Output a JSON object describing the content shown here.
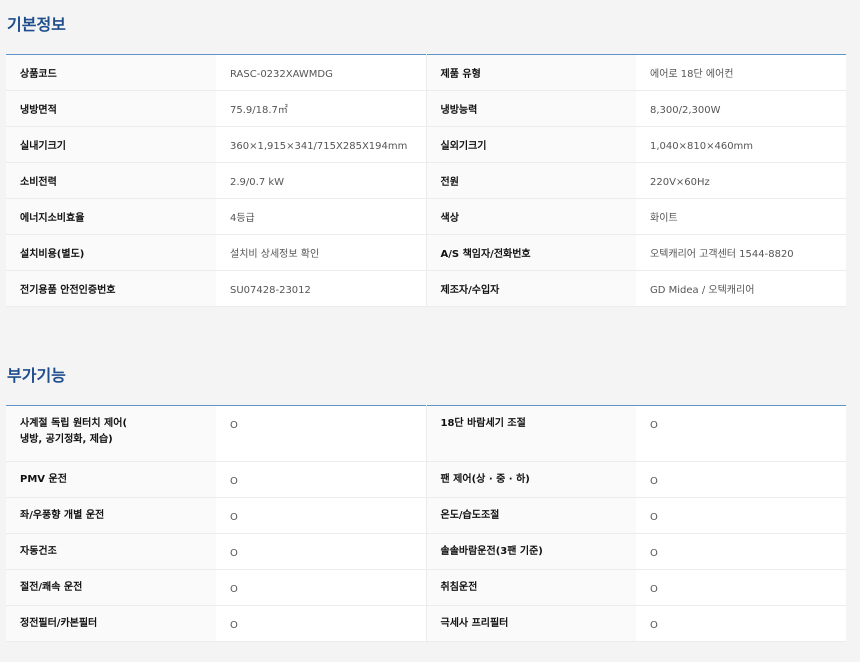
{
  "basic": {
    "title": "기본정보",
    "rows": [
      [
        {
          "label": "상품코드",
          "value": "RASC-0232XAWMDG"
        },
        {
          "label": "제품 유형",
          "value": "에어로 18단 에어컨"
        }
      ],
      [
        {
          "label": "냉방면적",
          "value": "75.9/18.7㎡"
        },
        {
          "label": "냉방능력",
          "value": "8,300/2,300W"
        }
      ],
      [
        {
          "label": "실내기크기",
          "value": "360×1,915×341/715X285X194mm"
        },
        {
          "label": "실외기크기",
          "value": "1,040×810×460mm"
        }
      ],
      [
        {
          "label": "소비전력",
          "value": "2.9/0.7 kW"
        },
        {
          "label": "전원",
          "value": "220V×60Hz"
        }
      ],
      [
        {
          "label": "에너지소비효율",
          "value": "4등급"
        },
        {
          "label": "색상",
          "value": "화이트"
        }
      ],
      [
        {
          "label": "설치비용(별도)",
          "value": "설치비 상세정보 확인"
        },
        {
          "label": "A/S 책임자/전화번호",
          "value": "오텍캐리어 고객센터 1544-8820"
        }
      ],
      [
        {
          "label": "전기용품 안전인증번호",
          "value": "SU07428-23012"
        },
        {
          "label": "제조자/수입자",
          "value": "GD Midea / 오텍캐리어"
        }
      ]
    ]
  },
  "extra": {
    "title": "부가기능",
    "rows": [
      [
        {
          "label": "사계절 독립 원터치 제어(\n냉방, 공기정화, 제습)",
          "value": "O"
        },
        {
          "label": "18단 바람세기 조절",
          "value": "O"
        }
      ],
      [
        {
          "label": "PMV 운전",
          "value": "O"
        },
        {
          "label": "팬 제어(상 · 중 · 하)",
          "value": "O"
        }
      ],
      [
        {
          "label": "좌/우풍향 개별 운전",
          "value": "O"
        },
        {
          "label": "온도/습도조절",
          "value": "O"
        }
      ],
      [
        {
          "label": "자동건조",
          "value": "O"
        },
        {
          "label": "솔솔바람운전(3팬 기준)",
          "value": "O"
        }
      ],
      [
        {
          "label": "절전/쾌속 운전",
          "value": "O"
        },
        {
          "label": "취침운전",
          "value": "O"
        }
      ],
      [
        {
          "label": "정전필터/카본필터",
          "value": "O"
        },
        {
          "label": "극세사 프리필터",
          "value": "O"
        }
      ]
    ]
  }
}
